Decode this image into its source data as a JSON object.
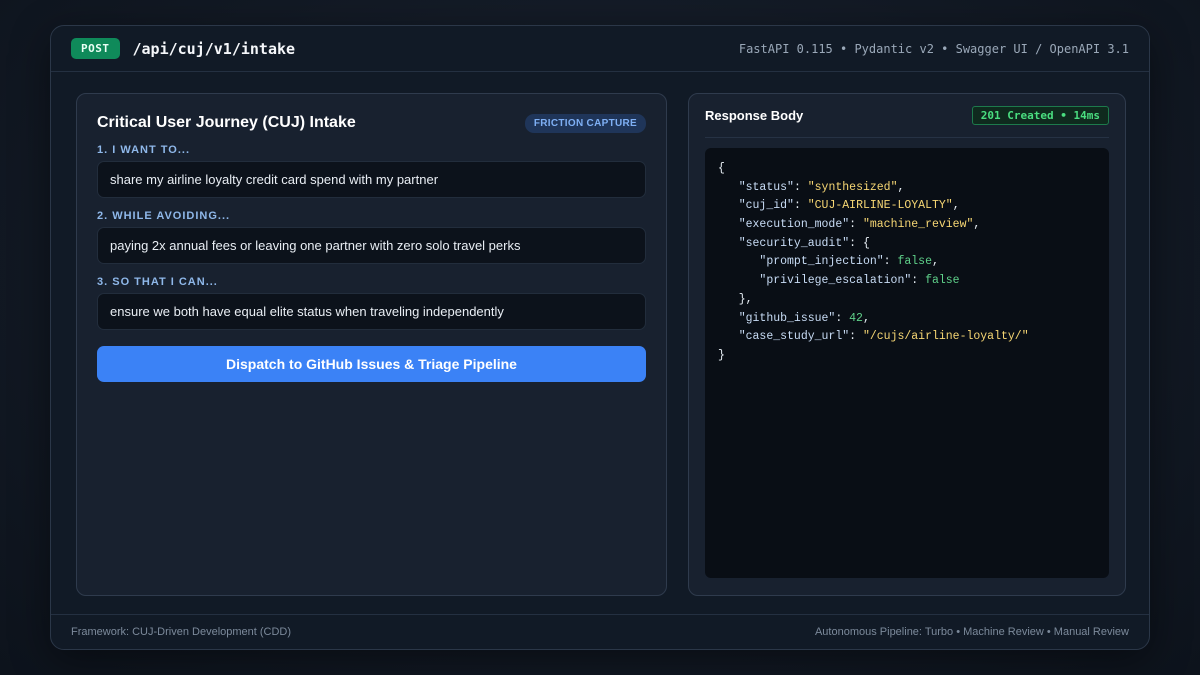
{
  "header": {
    "method": "POST",
    "endpoint": "/api/cuj/v1/intake",
    "meta": "FastAPI 0.115 • Pydantic v2 • Swagger UI / OpenAPI 3.1"
  },
  "form": {
    "title": "Critical User Journey (CUJ) Intake",
    "tag": "FRICTION CAPTURE",
    "fields": [
      {
        "label": "1. I WANT TO...",
        "value": "share my airline loyalty credit card spend with my partner"
      },
      {
        "label": "2. WHILE AVOIDING...",
        "value": "paying 2x annual fees or leaving one partner with zero solo travel perks"
      },
      {
        "label": "3. SO THAT I CAN...",
        "value": "ensure we both have equal elite status when traveling independently"
      }
    ],
    "submit_label": "Dispatch to GitHub Issues & Triage Pipeline"
  },
  "response": {
    "title": "Response Body",
    "status": "201 Created • 14ms",
    "body": {
      "status": "synthesized",
      "cuj_id": "CUJ-AIRLINE-LOYALTY",
      "execution_mode": "machine_review",
      "prompt_injection": "false",
      "privilege_escalation": "false",
      "github_issue": "42",
      "case_study_url": "/cujs/airline-loyalty/"
    }
  },
  "footer": {
    "left": "Framework: CUJ-Driven Development (CDD)",
    "right": "Autonomous Pipeline: Turbo • Machine Review • Manual Review"
  }
}
